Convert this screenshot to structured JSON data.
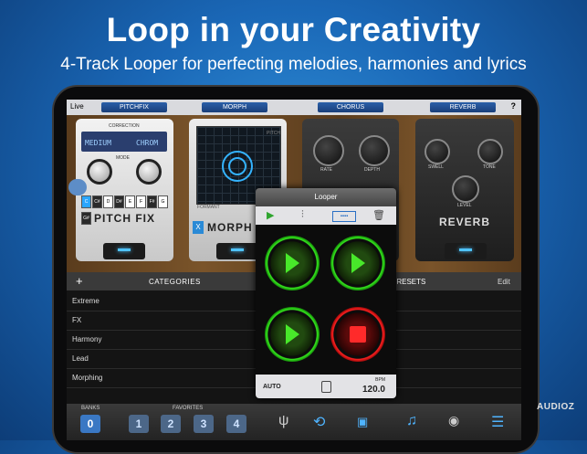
{
  "hero": {
    "title": "Loop in your Creativity",
    "subtitle": "4-Track Looper for perfecting melodies, harmonies and lyrics"
  },
  "topbar": {
    "live_label": "Live",
    "tabs": [
      "PITCHFIX",
      "MORPH",
      "CHORUS",
      "REVERB"
    ],
    "help": "?"
  },
  "pitchfix": {
    "correction_label": "CORRECTION",
    "lcd_left": "MEDIUM",
    "lcd_right": "CHROM",
    "mode_label": "MODE",
    "keys": [
      "C",
      "C#",
      "D",
      "D#",
      "E",
      "F",
      "F#",
      "G",
      "G#",
      "A",
      "A#",
      "B"
    ],
    "name": "PITCH FIX"
  },
  "morph": {
    "pitch_label": "PITCH",
    "formant_label": "FORMANT",
    "x_button": "X",
    "name": "MORPH"
  },
  "chorus": {
    "rate_label": "RATE",
    "depth_label": "DEPTH"
  },
  "reverb": {
    "swell_label": "SWELL",
    "tone_label": "TONE",
    "level_label": "LEVEL",
    "name": "REVERB"
  },
  "categories": {
    "add": "+",
    "title": "CATEGORIES",
    "presets_title": "PRESETS",
    "edit": "Edit",
    "items": [
      "Extreme",
      "FX",
      "Harmony",
      "Lead",
      "Morphing"
    ]
  },
  "bottombar": {
    "banks_label": "BANKS",
    "bank_value": "0",
    "favorites_label": "FAVORITES",
    "favorites": [
      "1",
      "2",
      "3",
      "4"
    ]
  },
  "looper": {
    "title": "Looper",
    "auto": "AUTO",
    "bpm_label": "BPM",
    "bpm_value": "120.0",
    "tracks": [
      "play",
      "play",
      "play",
      "stop"
    ]
  },
  "watermark": "AUDIOZ",
  "colors": {
    "accent": "#3a78c4",
    "looper_green": "#35e81d",
    "looper_red": "#ff2020"
  }
}
